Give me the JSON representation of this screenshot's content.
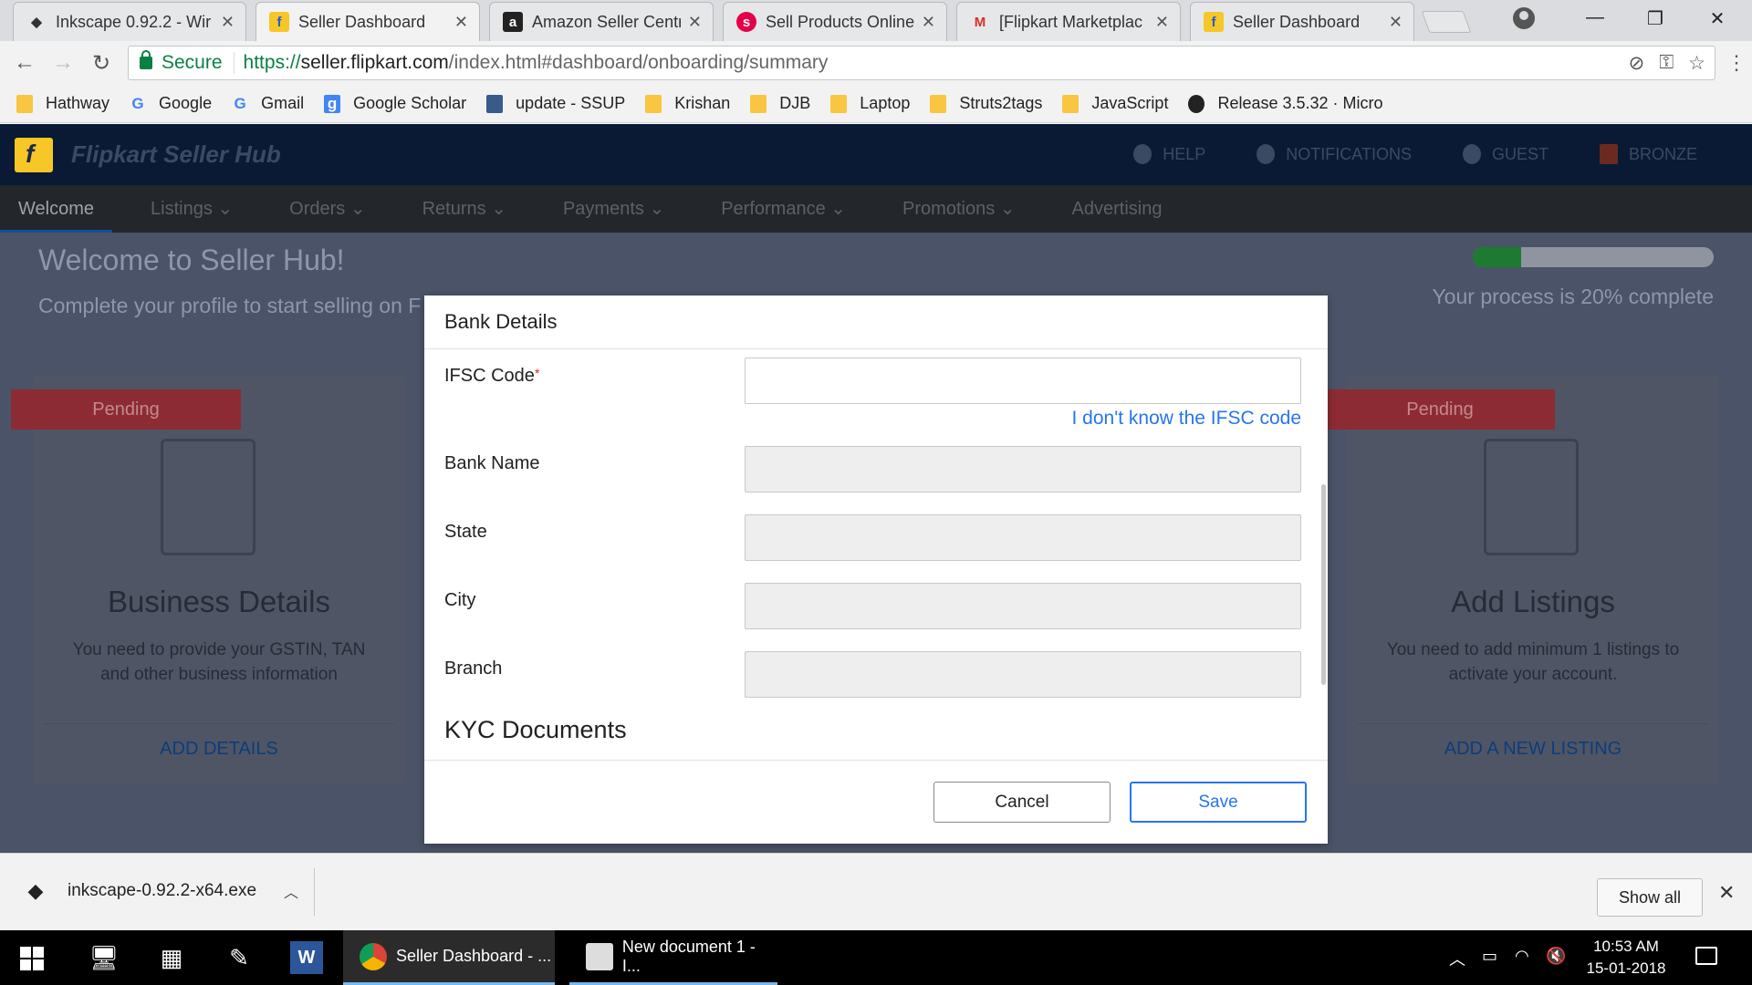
{
  "tabs": [
    {
      "title": "Inkscape 0.92.2 - Wir",
      "favicon": "inkscape-icon"
    },
    {
      "title": "Seller Dashboard",
      "favicon": "flipkart-icon",
      "active": true
    },
    {
      "title": "Amazon Seller Centr",
      "favicon": "amazon-icon"
    },
    {
      "title": "Sell Products Online",
      "favicon": "snapdeal-icon"
    },
    {
      "title": "[Flipkart Marketplac",
      "favicon": "gmail-icon"
    },
    {
      "title": "Seller Dashboard",
      "favicon": "flipkart-icon"
    }
  ],
  "toolbar": {
    "secure_label": "Secure",
    "url_scheme": "https://",
    "url_host": "seller.flipkart.com",
    "url_rest": "/index.html#dashboard/onboarding/summary"
  },
  "bookmarks": [
    {
      "label": "Hathway",
      "icon": "folder-icon"
    },
    {
      "label": "Google",
      "icon": "google-icon"
    },
    {
      "label": "Gmail",
      "icon": "google-icon"
    },
    {
      "label": "Google Scholar",
      "icon": "scholar-icon"
    },
    {
      "label": "update - SSUP",
      "icon": "page-icon"
    },
    {
      "label": "Krishan",
      "icon": "folder-icon"
    },
    {
      "label": "DJB",
      "icon": "folder-icon"
    },
    {
      "label": "Laptop",
      "icon": "folder-icon"
    },
    {
      "label": "Struts2tags",
      "icon": "folder-icon"
    },
    {
      "label": "JavaScript",
      "icon": "folder-icon"
    },
    {
      "label": "Release 3.5.32 · Micro",
      "icon": "github-icon"
    }
  ],
  "hub": {
    "title": "Flipkart Seller Hub",
    "nav_right": [
      "HELP",
      "NOTIFICATIONS",
      "GUEST",
      "BRONZE"
    ],
    "menu": [
      "Welcome",
      "Listings",
      "Orders",
      "Returns",
      "Payments",
      "Performance",
      "Promotions",
      "Advertising"
    ],
    "welcome": "Welcome to Seller Hub!",
    "complete_msg": "Complete your profile to start selling on F",
    "progress_fraction": 0.2,
    "progress_text": "Your process is 20% complete",
    "accent_color": "#2874f0"
  },
  "cards": [
    {
      "status": "Pending",
      "title": "Business Details",
      "desc": "You need to provide your GSTIN, TAN and other business information",
      "link": "ADD DETAILS"
    },
    {
      "status": "Pending",
      "title": "Add Listings",
      "desc": "You need to add minimum 1 listings to activate your account.",
      "link": "ADD A NEW LISTING"
    }
  ],
  "modal": {
    "title": "Bank Details",
    "ifsc_label": "IFSC Code",
    "required_mark": "*",
    "ifsc_link": "I don't know the IFSC code",
    "bank_name_label": "Bank Name",
    "state_label": "State",
    "city_label": "City",
    "branch_label": "Branch",
    "kyc_heading": "KYC Documents",
    "cancel_label": "Cancel",
    "save_label": "Save"
  },
  "download": {
    "filename": "inkscape-0.92.2-x64.exe",
    "show_all": "Show all"
  },
  "taskbar": {
    "apps": [
      {
        "label": "Seller Dashboard - ..."
      },
      {
        "label": "New document 1 - I..."
      }
    ],
    "time": "10:53 AM",
    "date": "15-01-2018"
  }
}
